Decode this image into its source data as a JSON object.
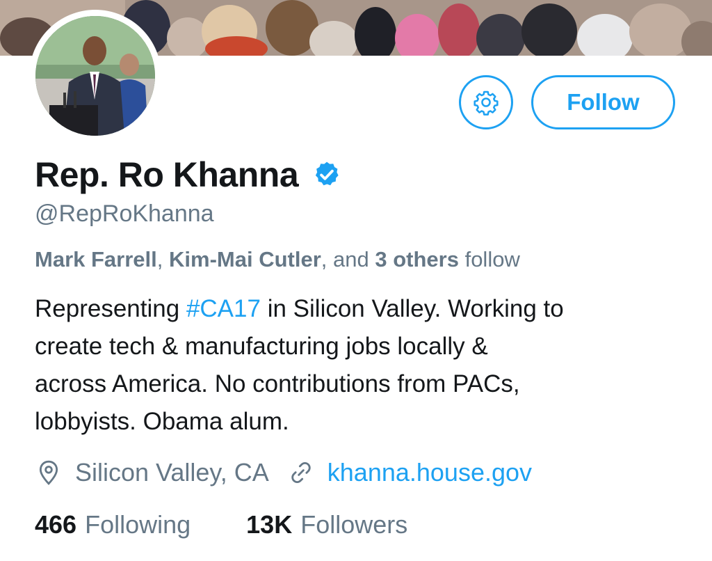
{
  "profile": {
    "name": "Rep. Ro Khanna",
    "handle": "@RepRoKhanna",
    "verified": true
  },
  "actions": {
    "settings_icon": "gear-icon",
    "follow_label": "Follow"
  },
  "followed_by": {
    "name1": "Mark Farrell",
    "sep1": ",",
    "name2": "Kim-Mai Cutler",
    "sep2": ", and",
    "others": "3 others",
    "suffix": "follow"
  },
  "bio": {
    "line1_before": "Representing",
    "hashtag": "#CA17",
    "line1_after": "in Silicon Valley. Working to",
    "line2": "create tech & manufacturing jobs locally &",
    "line3": "across America. No contributions from PACs,",
    "line4": "lobbyists. Obama alum."
  },
  "meta": {
    "location_icon": "location-pin-icon",
    "location": "Silicon Valley, CA",
    "link_icon": "link-icon",
    "website": "khanna.house.gov"
  },
  "stats": {
    "following_count": "466",
    "following_label": "Following",
    "followers_count": "13K",
    "followers_label": "Followers"
  },
  "colors": {
    "accent": "#1da1f2",
    "text": "#14171a",
    "secondary": "#657786"
  }
}
